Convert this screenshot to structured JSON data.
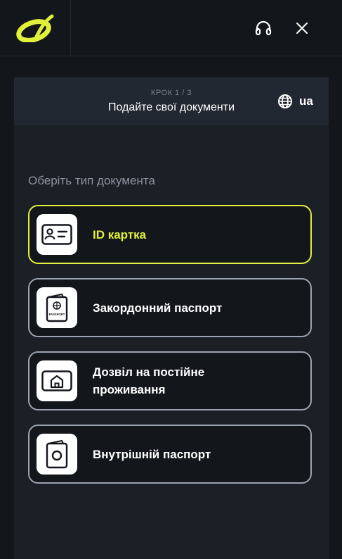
{
  "header": {
    "logo_icon": "ukrsibbank-logo",
    "support_icon": "headset-icon",
    "close_icon": "close-icon",
    "accent_color": "#e1f03a"
  },
  "step": {
    "label": "КРОК 1 / 3",
    "title": "Подайте свої документи"
  },
  "language": {
    "icon": "globe-icon",
    "value": "ua"
  },
  "document_selection": {
    "title": "Оберіть тип документа",
    "options": [
      {
        "label": "ID картка",
        "icon": "id-card-icon",
        "selected": true
      },
      {
        "label": "Закордонний паспорт",
        "icon": "international-passport-icon",
        "icon_text": "PASSPORT",
        "selected": false
      },
      {
        "label": "Дозвіл на постійне проживання",
        "icon": "residence-permit-icon",
        "selected": false
      },
      {
        "label": "Внутрішній паспорт",
        "icon": "internal-passport-icon",
        "selected": false
      }
    ]
  }
}
